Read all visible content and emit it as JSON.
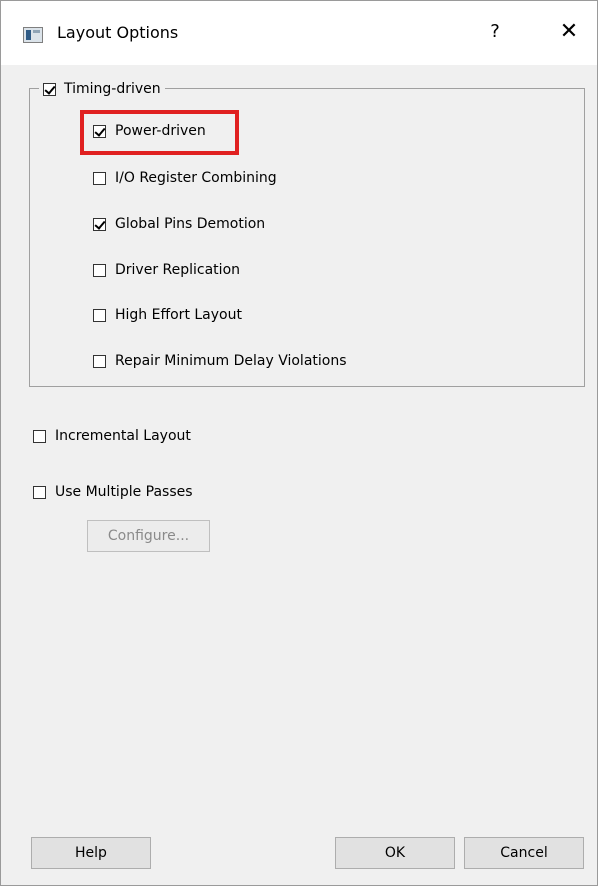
{
  "window": {
    "title": "Layout Options",
    "help_glyph": "?",
    "close_glyph": "✕",
    "app_icon": "window-app-icon"
  },
  "timing_group": {
    "label": "Timing-driven",
    "checked": true,
    "options": [
      {
        "label": "Power-driven",
        "checked": true,
        "highlighted": true
      },
      {
        "label": "I/O Register Combining",
        "checked": false
      },
      {
        "label": "Global Pins Demotion",
        "checked": true
      },
      {
        "label": "Driver Replication",
        "checked": false
      },
      {
        "label": "High Effort Layout",
        "checked": false
      },
      {
        "label": "Repair Minimum Delay Violations",
        "checked": false
      }
    ]
  },
  "incremental_layout": {
    "label": "Incremental Layout",
    "checked": false
  },
  "multiple_passes": {
    "label": "Use Multiple Passes",
    "checked": false
  },
  "configure_button": {
    "label": "Configure...",
    "enabled": false
  },
  "footer": {
    "help_label": "Help",
    "ok_label": "OK",
    "cancel_label": "Cancel"
  },
  "colors": {
    "highlight": "#e02020",
    "dialog_bg": "#f0f0f0",
    "button_bg": "#e1e1e1"
  }
}
